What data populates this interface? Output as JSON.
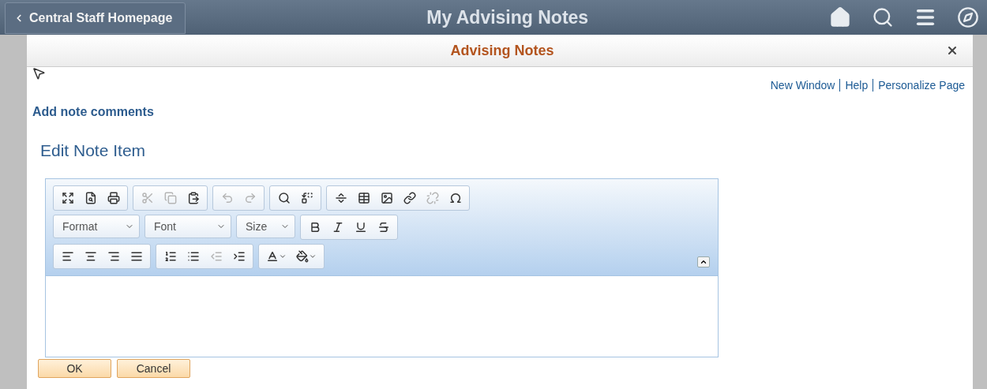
{
  "header": {
    "back_label": "Central Staff Homepage",
    "title": "My Advising Notes"
  },
  "modal": {
    "title": "Advising Notes",
    "links": [
      "New Window",
      "Help",
      "Personalize Page"
    ],
    "section_label": "Add note comments",
    "heading": "Edit Note Item"
  },
  "editor": {
    "toolbar_rows": [
      [
        [
          {
            "kind": "maximize",
            "disabled": false
          },
          {
            "kind": "preview",
            "disabled": false
          },
          {
            "kind": "print",
            "disabled": false
          }
        ],
        [
          {
            "kind": "cut",
            "disabled": true
          },
          {
            "kind": "copy",
            "disabled": true
          },
          {
            "kind": "paste",
            "disabled": false
          }
        ],
        [
          {
            "kind": "undo",
            "disabled": true
          },
          {
            "kind": "redo",
            "disabled": true
          }
        ],
        [
          {
            "kind": "find",
            "disabled": false
          },
          {
            "kind": "replace",
            "disabled": false
          }
        ],
        [
          {
            "kind": "rule",
            "disabled": false
          },
          {
            "kind": "table",
            "disabled": false
          },
          {
            "kind": "image",
            "disabled": false
          },
          {
            "kind": "link",
            "disabled": false
          },
          {
            "kind": "unlink",
            "disabled": true
          },
          {
            "kind": "special",
            "disabled": false
          }
        ]
      ],
      [
        [
          {
            "kind": "dropdown",
            "label": "Format",
            "disabled": false
          }
        ],
        [
          {
            "kind": "dropdown",
            "label": "Font",
            "disabled": false
          }
        ],
        [
          {
            "kind": "dropdown",
            "label": "Size",
            "disabled": false
          }
        ],
        [
          {
            "kind": "bold",
            "disabled": false
          },
          {
            "kind": "italic",
            "disabled": false
          },
          {
            "kind": "underline",
            "disabled": false
          },
          {
            "kind": "strike",
            "disabled": false
          }
        ]
      ],
      [
        [
          {
            "kind": "align-left",
            "disabled": false
          },
          {
            "kind": "align-center",
            "disabled": false
          },
          {
            "kind": "align-right",
            "disabled": false
          },
          {
            "kind": "justify",
            "disabled": false
          }
        ],
        [
          {
            "kind": "numbered",
            "disabled": false
          },
          {
            "kind": "bulleted",
            "disabled": false
          },
          {
            "kind": "outdent",
            "disabled": true
          },
          {
            "kind": "indent",
            "disabled": false
          }
        ],
        [
          {
            "kind": "text-color",
            "disabled": false
          },
          {
            "kind": "bg-color",
            "disabled": false
          }
        ]
      ]
    ]
  },
  "buttons": [
    "OK",
    "Cancel"
  ]
}
